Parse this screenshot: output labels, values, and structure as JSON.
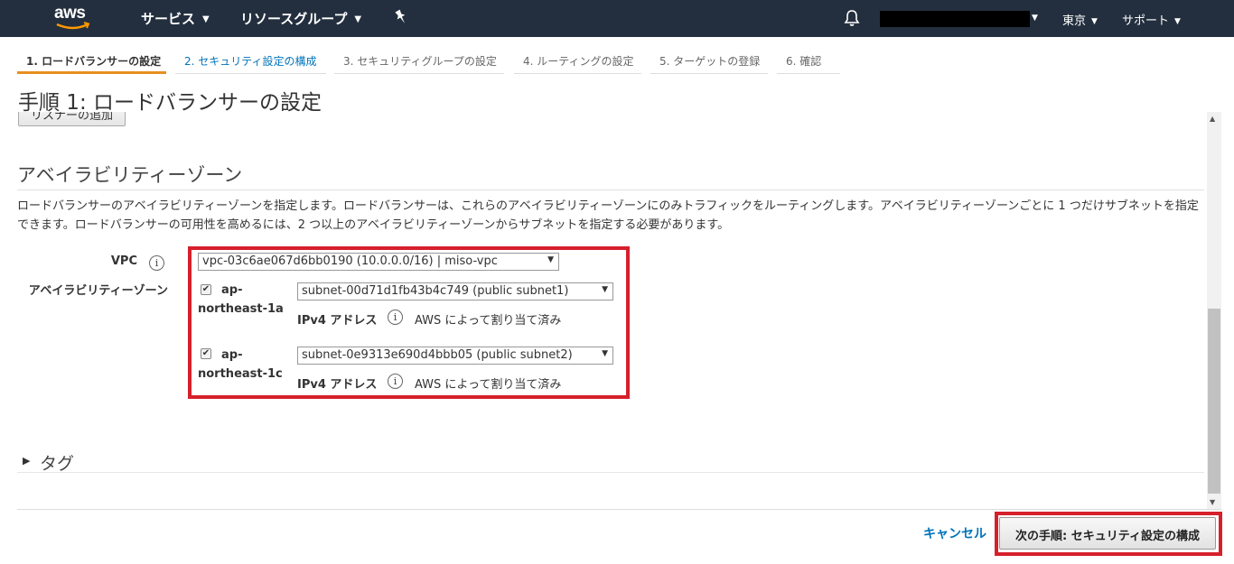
{
  "nav": {
    "logo": "aws",
    "services": "サービス",
    "resource_groups": "リソースグループ",
    "region": "東京",
    "support": "サポート"
  },
  "steps": [
    "1. ロードバランサーの設定",
    "2. セキュリティ設定の構成",
    "3. セキュリティグループの設定",
    "4. ルーティングの設定",
    "5. ターゲットの登録",
    "6. 確認"
  ],
  "page_title": "手順 1: ロードバランサーの設定",
  "clipped_button": "リスナーの追加",
  "az_section": {
    "title": "アベイラビリティーゾーン",
    "description": "ロードバランサーのアベイラビリティーゾーンを指定します。ロードバランサーは、これらのアベイラビリティーゾーンにのみトラフィックをルーティングします。アベイラビリティーゾーンごとに 1 つだけサブネットを指定できます。ロードバランサーの可用性を高めるには、2 つ以上のアベイラビリティーゾーンからサブネットを指定する必要があります。",
    "vpc_label": "VPC",
    "vpc_value": "vpc-03c6ae067d6bb0190 (10.0.0.0/16) | miso-vpc",
    "az_label": "アベイラビリティーゾーン",
    "zones": [
      {
        "name_line1": "ap-",
        "name_line2": "northeast-1a",
        "checked": true,
        "subnet": "subnet-00d71d1fb43b4c749 (public subnet1)",
        "ipv4_label": "IPv4 アドレス",
        "ipv4_value": "AWS によって割り当て済み"
      },
      {
        "name_line1": "ap-",
        "name_line2": "northeast-1c",
        "checked": true,
        "subnet": "subnet-0e9313e690d4bbb05 (public subnet2)",
        "ipv4_label": "IPv4 アドレス",
        "ipv4_value": "AWS によって割り当て済み"
      }
    ]
  },
  "tags_label": "タグ",
  "footer": {
    "cancel": "キャンセル",
    "next": "次の手順: セキュリティ設定の構成"
  },
  "colors": {
    "nav_bg": "#232f3e",
    "accent_orange": "#e88f20",
    "link_blue": "#0073bb",
    "highlight_red": "#d6202b"
  }
}
